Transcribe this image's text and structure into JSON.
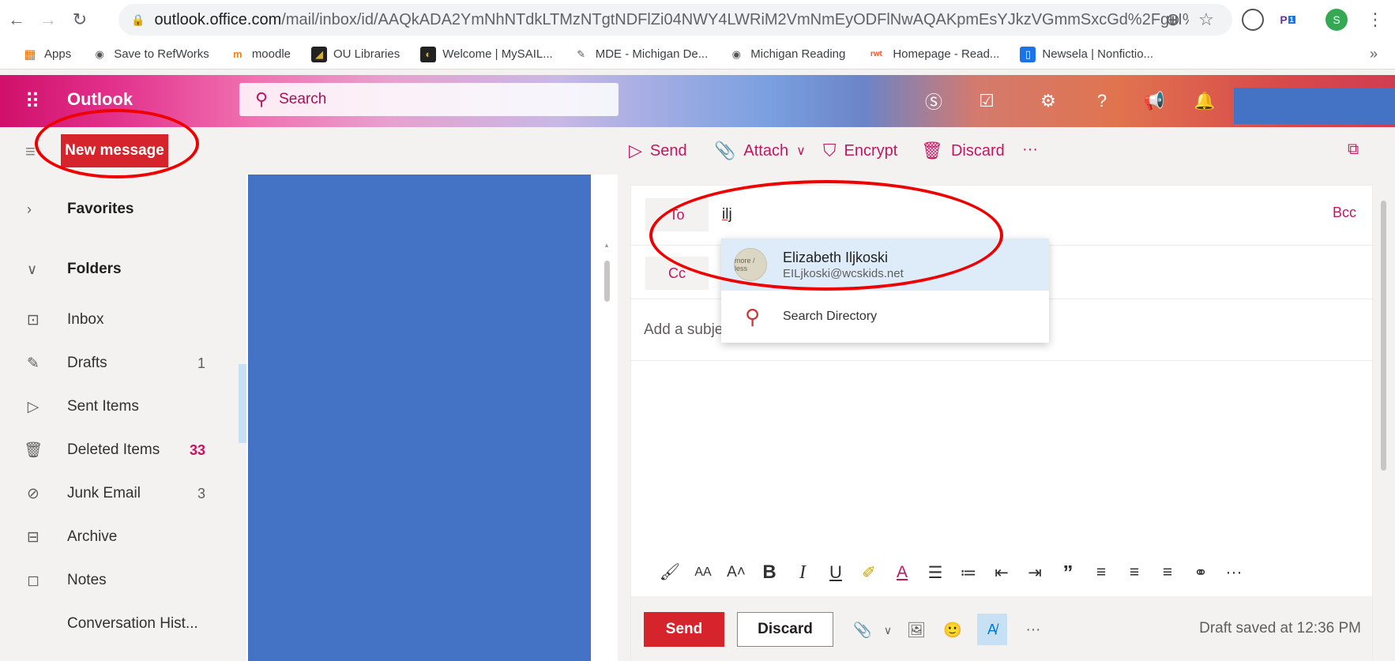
{
  "browser": {
    "url_host": "outlook.office.com",
    "url_path": "/mail/inbox/id/AAQkADA2YmNhNTdkLTMzNTgtNDFlZi04NWY4LWRiM2VmNmEyODFlNwAQAKpmEsYJkzVGmmSxcGd%2FguI%3D",
    "bookmarks": [
      "Apps",
      "Save to RefWorks",
      "moodle",
      "OU Libraries",
      "Welcome | MySAIL...",
      "MDE - Michigan De...",
      "Michigan Reading",
      "Homepage - Read...",
      "Newsela | Nonfictio..."
    ],
    "overflow": "»",
    "ext_badge": "1",
    "profile_initial": "S"
  },
  "header": {
    "brand": "Outlook",
    "search_placeholder": "Search"
  },
  "toolbar": {
    "new_message": "New message",
    "send": "Send",
    "attach": "Attach",
    "encrypt": "Encrypt",
    "discard": "Discard",
    "more": "···"
  },
  "nav": {
    "favorites": "Favorites",
    "folders": "Folders",
    "items": [
      {
        "label": "Inbox",
        "count": ""
      },
      {
        "label": "Drafts",
        "count": "1"
      },
      {
        "label": "Sent Items",
        "count": ""
      },
      {
        "label": "Deleted Items",
        "count": "33"
      },
      {
        "label": "Junk Email",
        "count": "3"
      },
      {
        "label": "Archive",
        "count": ""
      },
      {
        "label": "Notes",
        "count": ""
      },
      {
        "label": "Conversation Hist...",
        "count": ""
      }
    ]
  },
  "compose": {
    "to_label": "To",
    "to_value": "ilj",
    "cc_label": "Cc",
    "bcc_label": "Bcc",
    "subject_placeholder": "Add a subje",
    "suggestion": {
      "name": "Elizabeth Iljkoski",
      "email": "EILjkoski@wcskids.net",
      "avatar_text": "more / less",
      "search_directory": "Search Directory"
    },
    "send": "Send",
    "discard": "Discard",
    "more": "···",
    "draft_status": "Draft saved at 12:36 PM"
  },
  "format_bar": {
    "bold": "B",
    "italic": "I",
    "underline": "U",
    "font_size": "AA",
    "font_color": "A",
    "quote": "”",
    "more": "···"
  },
  "colors": {
    "accent": "#c4155f",
    "send_red": "#d5242c",
    "redaction_blue": "#4472c4",
    "annotation_red": "#ee0000"
  }
}
